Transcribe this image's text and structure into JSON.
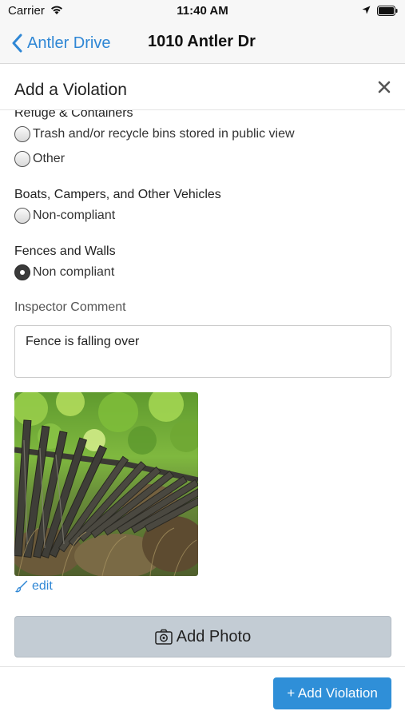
{
  "status_bar": {
    "carrier": "Carrier",
    "time": "11:40 AM",
    "icons": [
      "wifi-icon",
      "location-arrow-icon",
      "battery-icon"
    ]
  },
  "nav_bar": {
    "back_label": "Antler Drive",
    "title": "1010 Antler Dr"
  },
  "modal": {
    "title": "Add a Violation",
    "close_icon": "close-icon"
  },
  "categories": [
    {
      "label": "Refuge & Containers",
      "options": [
        {
          "label": "Trash and/or recycle bins stored in public view",
          "checked": false
        },
        {
          "label": "Other",
          "checked": false
        }
      ]
    },
    {
      "label": "Boats, Campers, and Other Vehicles",
      "options": [
        {
          "label": "Non-compliant",
          "checked": false
        }
      ]
    },
    {
      "label": "Fences and Walls",
      "options": [
        {
          "label": "Non compliant",
          "checked": true
        }
      ]
    }
  ],
  "comment": {
    "label": "Inspector Comment",
    "value": "Fence is falling over"
  },
  "photo": {
    "edit_label": "edit",
    "edit_icon": "brush-icon"
  },
  "add_photo": {
    "label": "Add Photo",
    "icon": "camera-icon"
  },
  "footer": {
    "add_violation_label": "+ Add Violation"
  },
  "colors": {
    "accent": "#2f87d5",
    "primary_button": "#2f8fd8",
    "secondary_button": "#c3ccd4"
  }
}
